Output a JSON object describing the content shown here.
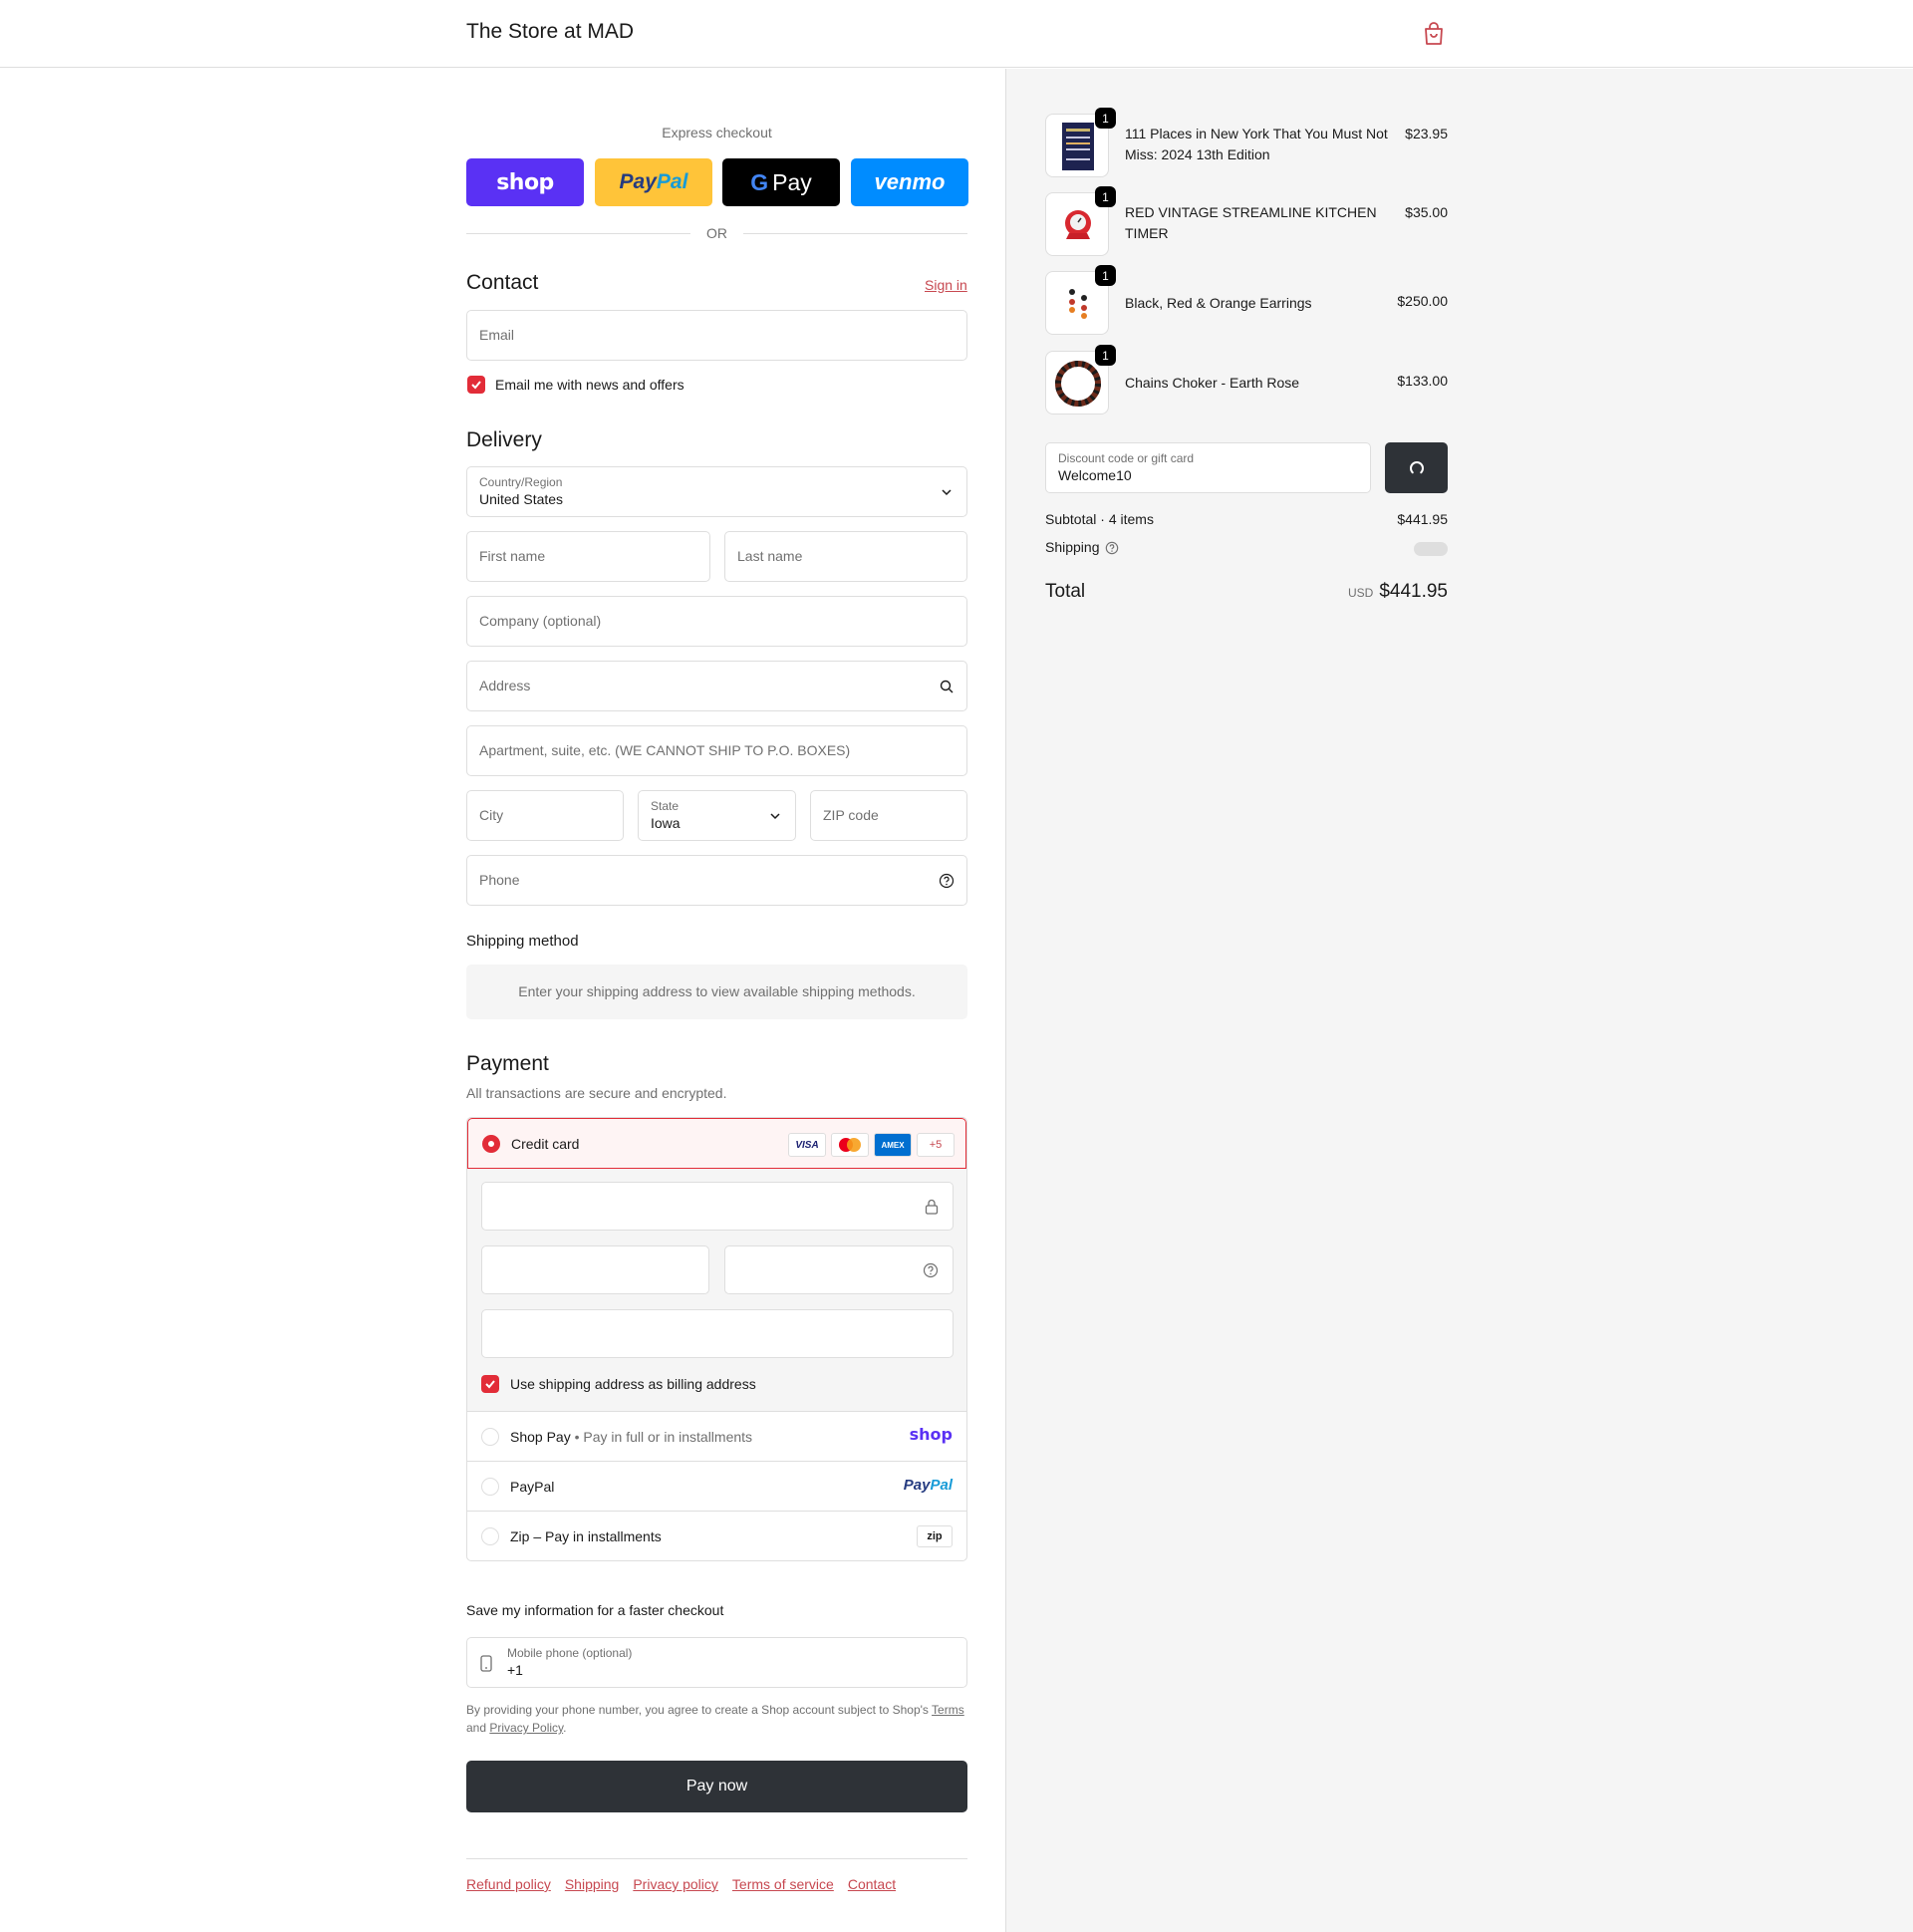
{
  "header": {
    "store_name": "The Store at MAD"
  },
  "express": {
    "title": "Express checkout",
    "shop_label": "shop",
    "paypal_label_1": "Pay",
    "paypal_label_2": "Pal",
    "gpay_g": "G",
    "gpay_label": "Pay",
    "venmo_label": "venmo",
    "or_label": "OR"
  },
  "contact": {
    "title": "Contact",
    "sign_in": "Sign in",
    "email_placeholder": "Email",
    "news_label": "Email me with news and offers"
  },
  "delivery": {
    "title": "Delivery",
    "country_label": "Country/Region",
    "country_value": "United States",
    "first_name": "First name",
    "last_name": "Last name",
    "company": "Company (optional)",
    "address": "Address",
    "apartment": "Apartment, suite, etc. (WE CANNOT SHIP TO P.O. BOXES)",
    "city": "City",
    "state_label": "State",
    "state_value": "Iowa",
    "zip": "ZIP code",
    "phone": "Phone"
  },
  "shipping_method": {
    "title": "Shipping method",
    "message": "Enter your shipping address to view available shipping methods."
  },
  "payment": {
    "title": "Payment",
    "subtitle": "All transactions are secure and encrypted.",
    "credit_card": "Credit card",
    "cards": [
      "VISA",
      "AMEX",
      "+5"
    ],
    "billing_label": "Use shipping address as billing address",
    "shop_pay": "Shop Pay",
    "shop_pay_note": "Pay in full or in installments",
    "shop_pay_logo": "shop",
    "paypal": "PayPal",
    "paypal_logo_1": "Pay",
    "paypal_logo_2": "Pal",
    "zip": "Zip – Pay in installments",
    "zip_logo": "zip"
  },
  "save_info": {
    "title": "Save my information for a faster checkout",
    "mobile_label": "Mobile phone (optional)",
    "mobile_value": "+1",
    "legal_1": "By providing your phone number, you agree to create a Shop account subject to Shop's ",
    "terms": "Terms",
    "legal_2": "and ",
    "privacy": "Privacy Policy",
    "legal_3": "."
  },
  "pay_now": "Pay now",
  "footer": {
    "links": [
      "Refund policy",
      "Shipping",
      "Privacy policy",
      "Terms of service",
      "Contact"
    ]
  },
  "summary": {
    "items": [
      {
        "name": "111 Places in New York That You Must Not Miss: 2024 13th Edition",
        "price": "$23.95",
        "qty": "1"
      },
      {
        "name": "RED VINTAGE STREAMLINE KITCHEN TIMER",
        "price": "$35.00",
        "qty": "1"
      },
      {
        "name": "Black, Red & Orange Earrings",
        "price": "$250.00",
        "qty": "1"
      },
      {
        "name": "Chains Choker - Earth Rose",
        "price": "$133.00",
        "qty": "1"
      }
    ],
    "discount_label": "Discount code or gift card",
    "discount_value": "Welcome10",
    "subtotal_label": "Subtotal · 4 items",
    "subtotal_value": "$441.95",
    "shipping_label": "Shipping",
    "total_label": "Total",
    "currency": "USD",
    "total_value": "$441.95"
  },
  "colors": {
    "accent": "#e22c38",
    "link": "#c74850",
    "dark_button": "#2e3237",
    "shop_purple": "#5a31f4",
    "paypal_yellow": "#ffc439",
    "venmo_blue": "#008cff"
  }
}
